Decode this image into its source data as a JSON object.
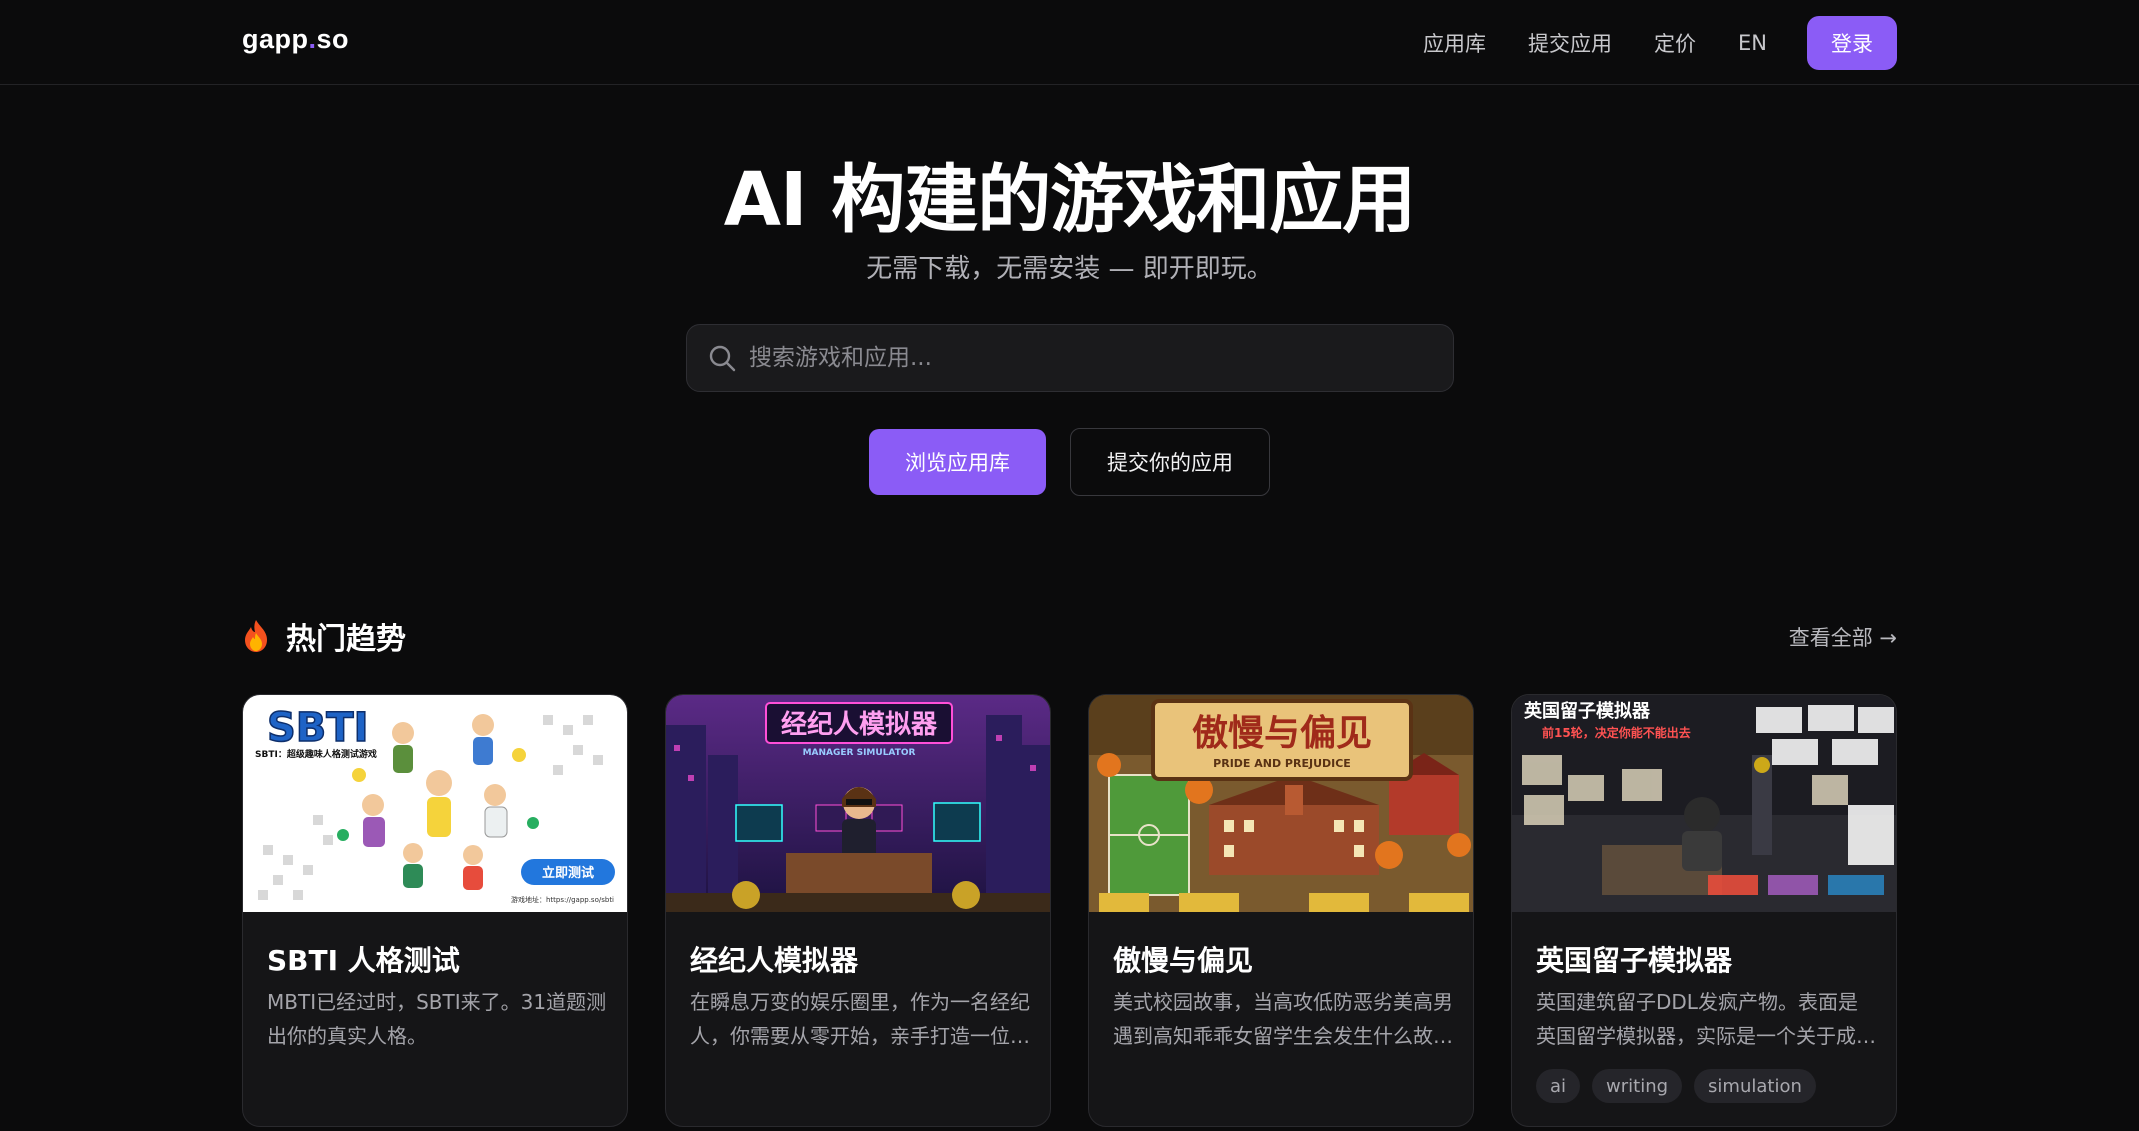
{
  "nav": {
    "logo_left": "gapp",
    "logo_dot": ".",
    "logo_right": "so",
    "links": [
      "应用库",
      "提交应用",
      "定价",
      "EN"
    ],
    "login": "登录"
  },
  "hero": {
    "title": "AI 构建的游戏和应用",
    "subtitle": "无需下载，无需安装 — 即开即玩。",
    "search_placeholder": "搜索游戏和应用...",
    "primary_button": "浏览应用库",
    "secondary_button": "提交你的应用"
  },
  "trending": {
    "title": "热门趋势",
    "view_all": "查看全部 →",
    "cards": [
      {
        "title": "SBTI 人格测试",
        "desc": "MBTI已经过时，SBTI来了。31道题测出你的真实人格。",
        "thumb_title": "SBTI",
        "thumb_sub": "SBTI：超级趣味人格测试游戏",
        "thumb_button": "立即测试",
        "thumb_footer": "游戏地址：https://gapp.so/sbti",
        "tags": []
      },
      {
        "title": "经纪人模拟器",
        "desc": "在瞬息万变的娱乐圈里，作为一名经纪人，你需要从零开始，亲手打造一位巨星。",
        "thumb_title": "经纪人模拟器",
        "thumb_sub": "MANAGER SIMULATOR",
        "tags": []
      },
      {
        "title": "傲慢与偏见",
        "desc": "美式校园故事，当高攻低防恶劣美高男遇到高知乖乖女留学生会发生什么故事。",
        "thumb_title": "傲慢与偏见",
        "thumb_sub": "PRIDE AND PREJUDICE",
        "tags": []
      },
      {
        "title": "英国留子模拟器",
        "desc": "英国建筑留子DDL发疯产物。表面是英国留学模拟器，实际是一个关于成长的故事。",
        "thumb_title": "英国留子模拟器",
        "thumb_sub": "前15轮，决定你能不能出去",
        "tags": [
          "ai",
          "writing",
          "simulation"
        ]
      }
    ]
  },
  "colors": {
    "accent": "#8b5cf6",
    "background": "#0b0b0c",
    "card": "#151517"
  }
}
